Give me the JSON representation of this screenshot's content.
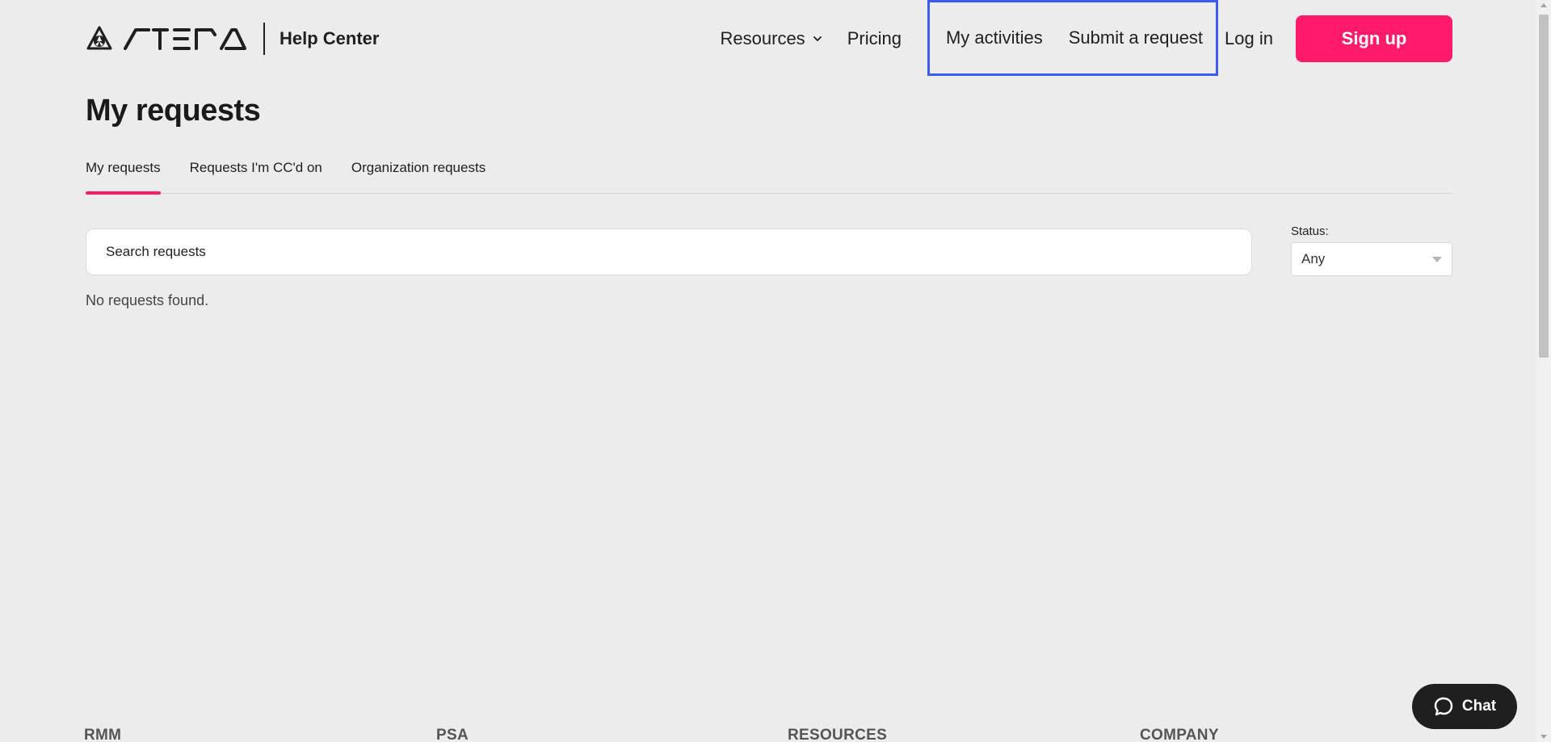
{
  "header": {
    "logo_alt": "Atera",
    "help_center": "Help Center",
    "nav": {
      "resources": "Resources",
      "pricing": "Pricing",
      "my_activities": "My activities",
      "submit_request": "Submit a request",
      "login": "Log in",
      "signup": "Sign up"
    }
  },
  "page": {
    "title": "My requests",
    "tabs": [
      {
        "label": "My requests",
        "active": true
      },
      {
        "label": "Requests I'm CC'd on",
        "active": false
      },
      {
        "label": "Organization requests",
        "active": false
      }
    ],
    "search_placeholder": "Search requests",
    "empty_message": "No requests found.",
    "status_label": "Status:",
    "status_value": "Any"
  },
  "footer": {
    "headings": [
      "RMM",
      "PSA",
      "RESOURCES",
      "COMPANY"
    ]
  },
  "chat": {
    "label": "Chat"
  },
  "colors": {
    "accent": "#ff1a6a",
    "highlight_border": "#3d5af1",
    "background": "#ececec"
  }
}
